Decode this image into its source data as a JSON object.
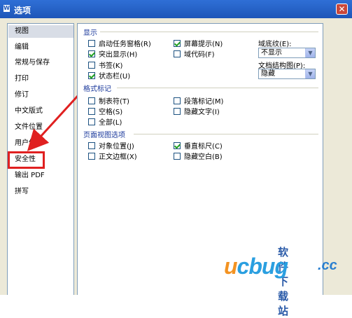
{
  "window": {
    "title": "选项",
    "icon": "app-w-icon",
    "close_symbol": "✕"
  },
  "sidebar": {
    "items": [
      {
        "label": "视图",
        "selected": true
      },
      {
        "label": "编辑"
      },
      {
        "label": "常规与保存"
      },
      {
        "label": "打印"
      },
      {
        "label": "修订"
      },
      {
        "label": "中文版式"
      },
      {
        "label": "文件位置"
      },
      {
        "label": "用户信息"
      },
      {
        "label": "安全性",
        "highlighted": true
      },
      {
        "label": "输出 PDF"
      },
      {
        "label": "拼写"
      }
    ]
  },
  "sections": {
    "display": {
      "title": "显示",
      "options": [
        {
          "label": "启动任务窗格(R)",
          "checked": false
        },
        {
          "label": "突出显示(H)",
          "checked": true
        },
        {
          "label": "书签(K)",
          "checked": false
        },
        {
          "label": "状态栏(U)",
          "checked": true
        },
        {
          "label": "屏幕提示(N)",
          "checked": true
        },
        {
          "label": "域代码(F)",
          "checked": false
        }
      ],
      "field_shading": {
        "label": "域底纹(E):",
        "value": "不显示"
      },
      "doc_map": {
        "label": "文档结构图(P):",
        "value": "隐藏"
      }
    },
    "format_marks": {
      "title": "格式标记",
      "options": [
        {
          "label": "制表符(T)",
          "checked": false
        },
        {
          "label": "空格(S)",
          "checked": false
        },
        {
          "label": "全部(L)",
          "checked": false
        },
        {
          "label": "段落标记(M)",
          "checked": false
        },
        {
          "label": "隐藏文字(I)",
          "checked": false
        }
      ]
    },
    "page_view": {
      "title": "页面视图选项",
      "options": [
        {
          "label": "对象位置(J)",
          "checked": false
        },
        {
          "label": "正文边框(X)",
          "checked": false
        },
        {
          "label": "垂直标尺(C)",
          "checked": true
        },
        {
          "label": "隐藏空白(B)",
          "checked": false
        }
      ]
    }
  },
  "watermark": {
    "top": "软件下载站",
    "main_y": "u",
    "main_rest": "cbug",
    "suffix": ".cc"
  },
  "colors": {
    "titlebar": "#1e56b8",
    "highlight": "#e02020",
    "section_title": "#1c3a9c",
    "check": "#21a121"
  }
}
